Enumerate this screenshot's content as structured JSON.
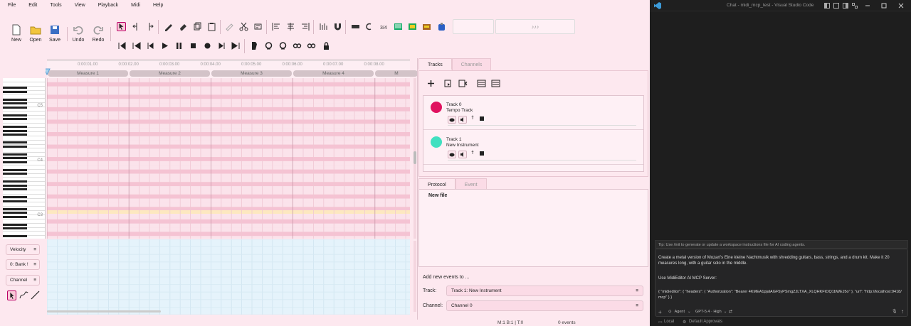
{
  "menu": [
    "File",
    "Edit",
    "Tools",
    "View",
    "Playback",
    "Midi",
    "Help"
  ],
  "toolbar": {
    "new_label": "New",
    "open_label": "Open",
    "save_label": "Save",
    "undo_label": "Undo",
    "redo_label": "Redo",
    "mini_box_text": "♪♪♪"
  },
  "ruler": {
    "times": [
      "0:00:01.00",
      "0:00:02.00",
      "0:00:03.00",
      "0:00:04.00",
      "0:00:05.00",
      "0:00:06.00",
      "0:00:07.00",
      "0:00:08.00"
    ],
    "measures": [
      "Measure 1",
      "Measure 2",
      "Measure 3",
      "Measure 4",
      "M"
    ]
  },
  "piano": {
    "octave_labels": [
      "C5",
      "C4",
      "C3"
    ]
  },
  "controls": {
    "velocity": "Velocity",
    "bank": "0: Bank !",
    "channel": "Channel"
  },
  "tracks_panel": {
    "tabs": [
      "Tracks",
      "Channels"
    ],
    "tracks": [
      {
        "name": "Track 0",
        "sub": "Tempo Track",
        "color": "#e0115f"
      },
      {
        "name": "Track 1",
        "sub": "New Instrument",
        "color": "#40e0c0"
      }
    ]
  },
  "protocol_panel": {
    "tabs": [
      "Protocol",
      "Event"
    ],
    "entry": "New file"
  },
  "add_events": {
    "title": "Add new events to ...",
    "track_label": "Track:",
    "track_value": "Track 1: New Instrument",
    "channel_label": "Channel:",
    "channel_value": "Channel 0"
  },
  "status": {
    "position": "M:1 B:1 | T:0",
    "events": "0 events"
  },
  "vscode": {
    "title": "Chat - midi_mcp_test - Visual Studio Code",
    "tip": "Tip: Use /init to generate or update a workspace instructions file for AI coding agents.",
    "prompt1": "Create a metal version of Mozart's Eine kleine Nachtmusik with shredding guitars, bass, strings, and a drum kit. Make it 20 measures long, with a guitar solo in the middle.",
    "prompt2": "Use MidiEditor AI MCP Server:",
    "prompt3": "{ \"midieditor\": { \"headers\": { \"Authorization\": \"Bearer 4KMEA1pjalAGF5yPSmgZJLTXA_XLQHKFtOQ1bWEJ5o\" }, \"url\": \"http://localhost:9418/mcp\" } }",
    "agent": "Agent",
    "model": "GPT-5.4 · High",
    "local": "Local",
    "approvals": "Default Approvals"
  }
}
